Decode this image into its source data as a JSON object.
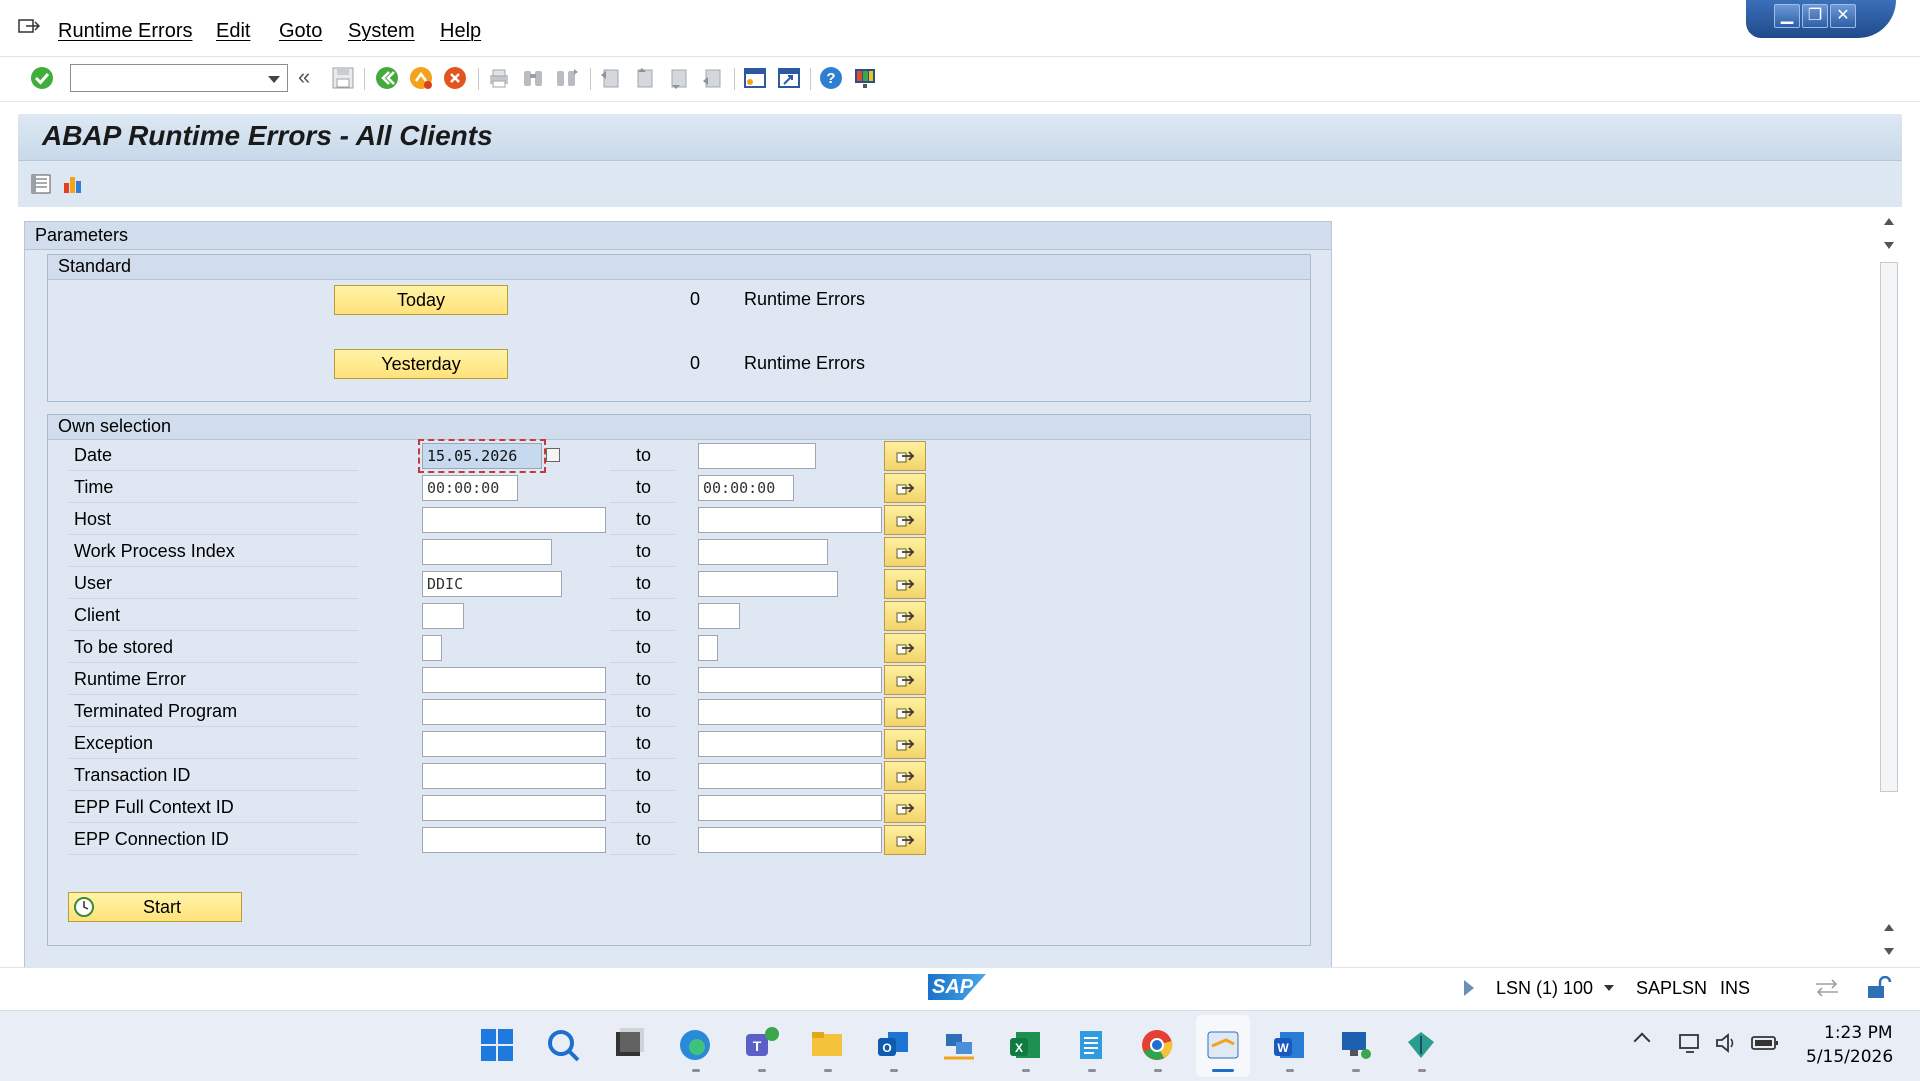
{
  "menu": {
    "items": [
      "Runtime Errors",
      "Edit",
      "Goto",
      "System",
      "Help"
    ]
  },
  "toolbar": {
    "command_field_value": "",
    "icons": [
      "enter-check-icon",
      "command-dropdown-icon",
      "collapse-icon",
      "save-icon",
      "back-icon",
      "exit-icon",
      "cancel-icon",
      "print-icon",
      "find-icon",
      "find-next-icon",
      "first-page-icon",
      "previous-page-icon",
      "next-page-icon",
      "last-page-icon",
      "new-session-icon",
      "create-shortcut-icon",
      "help-icon",
      "customize-layout-icon"
    ]
  },
  "title": "ABAP Runtime Errors - All Clients",
  "app_toolbar": {
    "icons": [
      "list-icon",
      "statistics-icon"
    ]
  },
  "parameters": {
    "title": "Parameters",
    "standard": {
      "title": "Standard",
      "rows": [
        {
          "button": "Today",
          "count": "0",
          "label": "Runtime Errors"
        },
        {
          "button": "Yesterday",
          "count": "0",
          "label": "Runtime Errors"
        }
      ]
    },
    "own_selection": {
      "title": "Own selection",
      "to_label": "to",
      "rows": [
        {
          "label": "Date",
          "from": "15.05.2026",
          "to": ""
        },
        {
          "label": "Time",
          "from": "00:00:00",
          "to": "00:00:00"
        },
        {
          "label": "Host",
          "from": "",
          "to": ""
        },
        {
          "label": "Work Process Index",
          "from": "",
          "to": ""
        },
        {
          "label": "User",
          "from": "DDIC",
          "to": ""
        },
        {
          "label": "Client",
          "from": "",
          "to": ""
        },
        {
          "label": "To be stored",
          "from": "",
          "to": ""
        },
        {
          "label": "Runtime Error",
          "from": "",
          "to": ""
        },
        {
          "label": "Terminated Program",
          "from": "",
          "to": ""
        },
        {
          "label": "Exception",
          "from": "",
          "to": ""
        },
        {
          "label": "Transaction ID",
          "from": "",
          "to": ""
        },
        {
          "label": "EPP Full Context ID",
          "from": "",
          "to": ""
        },
        {
          "label": "EPP Connection ID",
          "from": "",
          "to": ""
        }
      ],
      "start_button": "Start"
    }
  },
  "status_bar": {
    "logo": "SAP",
    "system": "LSN (1) 100",
    "server": "SAPLSN",
    "mode": "INS"
  },
  "taskbar": {
    "apps": [
      "windows-start-icon",
      "search-icon",
      "task-view-icon",
      "edge-icon",
      "teams-icon",
      "file-explorer-icon",
      "outlook-icon",
      "network-app-icon",
      "excel-icon",
      "notepad-icon",
      "chrome-icon",
      "sap-logon-icon",
      "word-icon",
      "remote-desktop-icon",
      "tool-app-icon"
    ],
    "clock_time": "1:23 PM",
    "clock_date": "5/15/2026"
  },
  "colors": {
    "accent_blue": "#1f4b8c",
    "button_yellow": "#ffe27a",
    "panel_blue": "#dfe8f2"
  }
}
